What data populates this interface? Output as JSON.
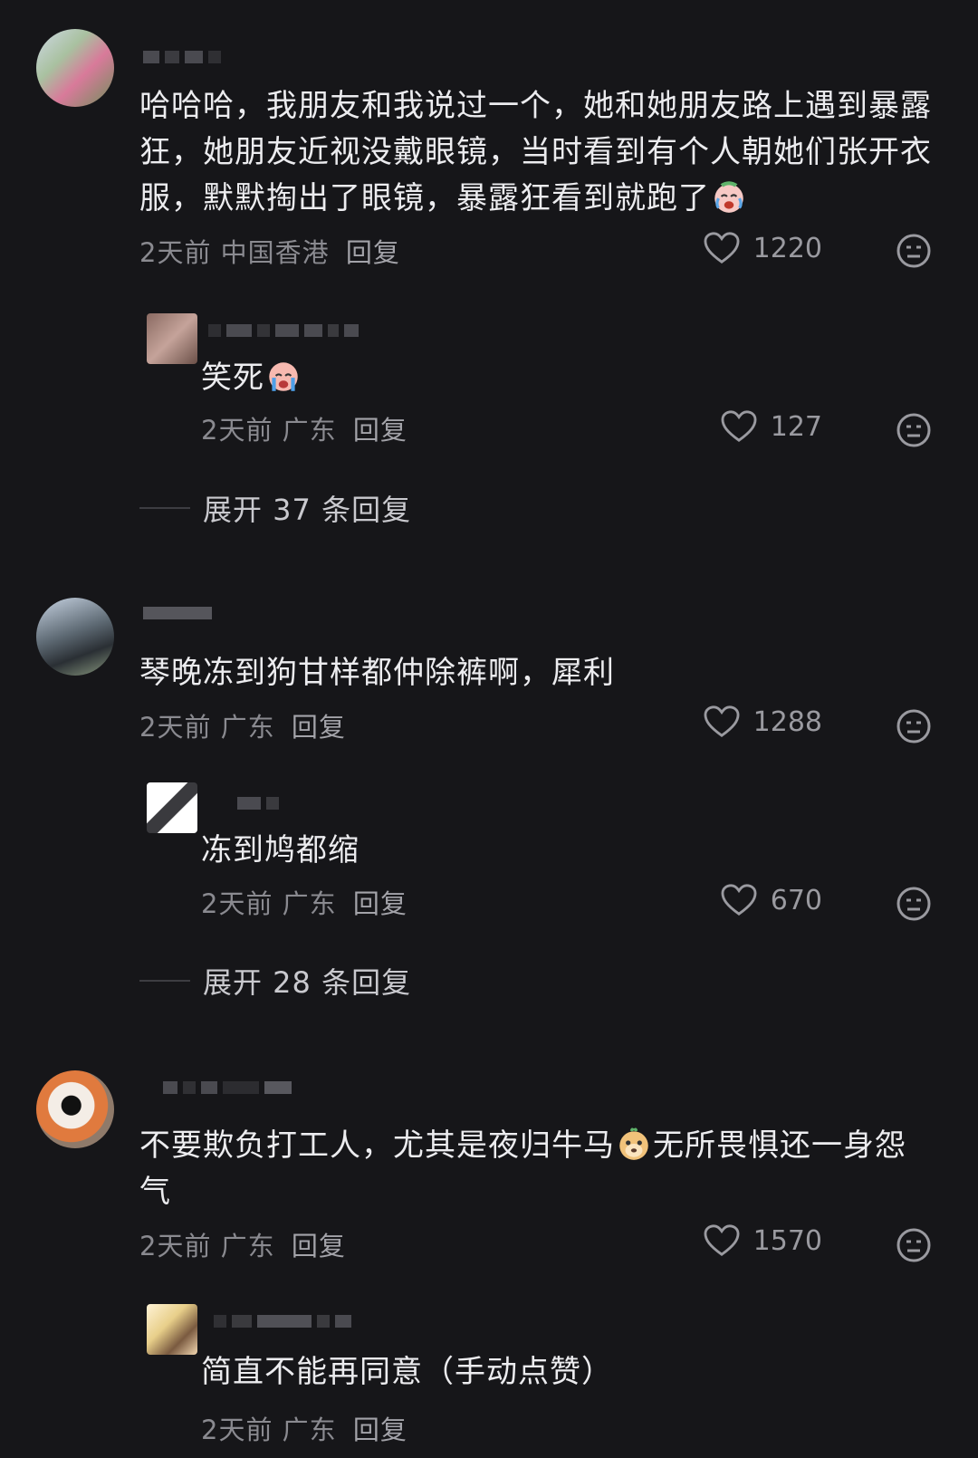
{
  "comments": [
    {
      "text": "哈哈哈，我朋友和我说过一个，她和她朋友路上遇到暴露狂，她朋友近视没戴眼镜，当时看到有个人朝她们张开衣服，默默掏出了眼镜，暴露狂看到就跑了",
      "emoji": "crying-laughing-emoji",
      "time": "2天前",
      "location": "中国香港",
      "reply_label": "回复",
      "likes": "1220",
      "replies": [
        {
          "text": "笑死",
          "emoji": "crying-emoji",
          "time": "2天前",
          "location": "广东",
          "reply_label": "回复",
          "likes": "127"
        }
      ],
      "expand_label": "展开 37 条回复"
    },
    {
      "text": "琴晚冻到狗甘样都仲除裤啊，犀利",
      "time": "2天前",
      "location": "广东",
      "reply_label": "回复",
      "likes": "1288",
      "replies": [
        {
          "text": "冻到鸠都缩",
          "time": "2天前",
          "location": "广东",
          "reply_label": "回复",
          "likes": "670"
        }
      ],
      "expand_label": "展开 28 条回复"
    },
    {
      "text_a": "不要欺负打工人，尤其是夜归牛马",
      "text_b": "无所畏惧还一身怨气",
      "emoji": "cow-horse-emoji",
      "time": "2天前",
      "location": "广东",
      "reply_label": "回复",
      "likes": "1570",
      "replies": [
        {
          "text": "简直不能再同意（手动点赞）",
          "time": "2天前",
          "location": "广东",
          "reply_label": "回复"
        }
      ]
    }
  ],
  "icons": {
    "like": "heart-icon",
    "react": "emoji-react-icon"
  },
  "colors": {
    "background": "#161619",
    "text": "#ececef",
    "meta": "#8a8a90"
  }
}
